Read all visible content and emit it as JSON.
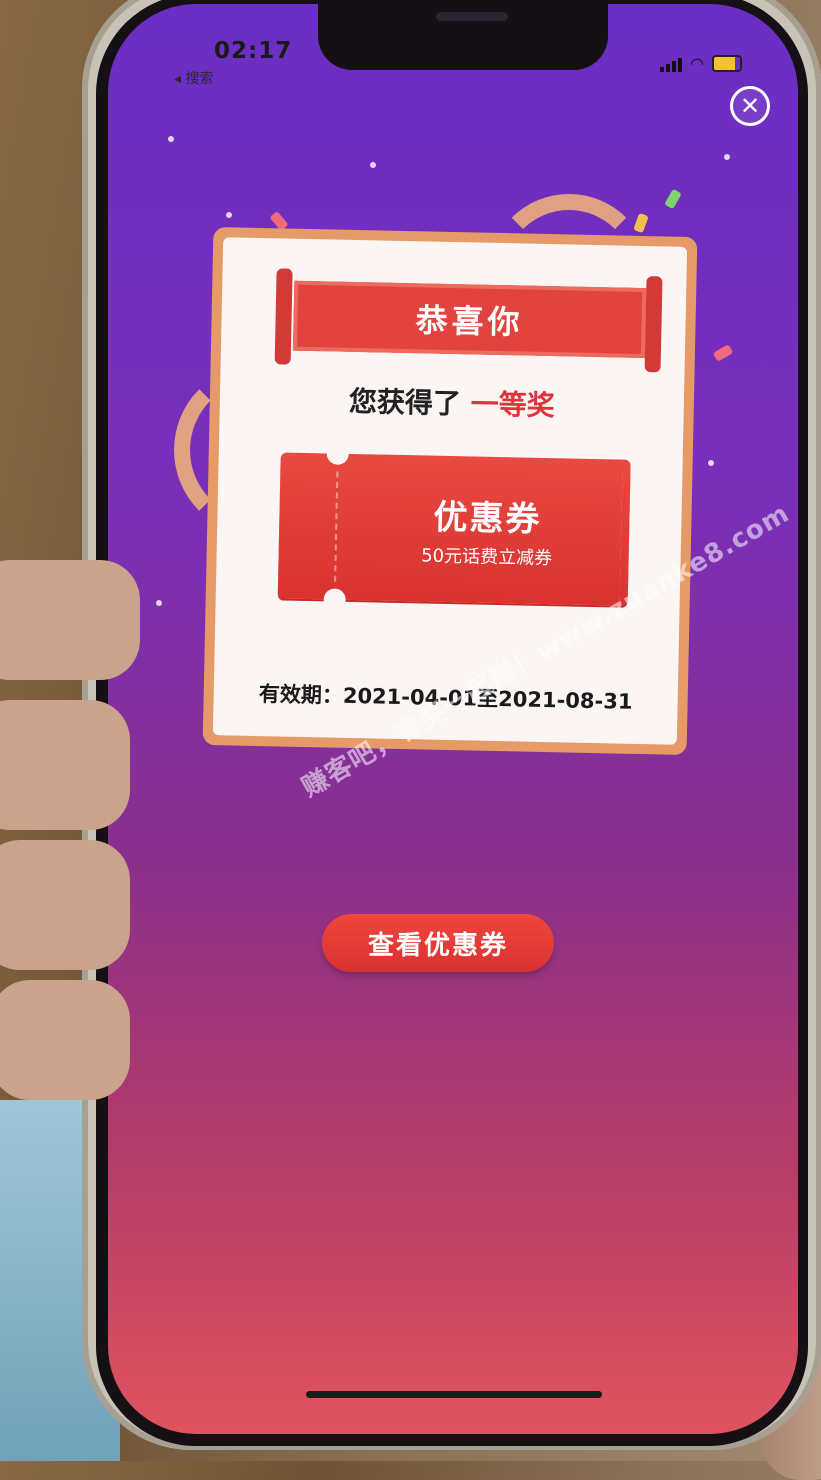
{
  "status_bar": {
    "time": "02:17",
    "back_label": "◂ 搜索"
  },
  "card": {
    "title": "恭喜你",
    "prize_prefix": "您获得了",
    "prize_name": "一等奖",
    "coupon": {
      "title": "优惠券",
      "subtitle": "50元话费立减券"
    },
    "validity": "有效期：2021-04-01至2021-08-31"
  },
  "actions": {
    "view_coupon_label": "查看优惠券",
    "close_symbol": "✕"
  },
  "watermark": "赚客吧，有奖一起赚！www.zuanke8.com",
  "colors": {
    "accent_red": "#e0333b",
    "card_border": "#e69a68",
    "background_top": "#6a2ec4",
    "background_bottom": "#e0535e"
  },
  "icons": [
    "back-arrow-icon",
    "signal-icon",
    "wifi-icon",
    "battery-icon",
    "close-icon"
  ]
}
